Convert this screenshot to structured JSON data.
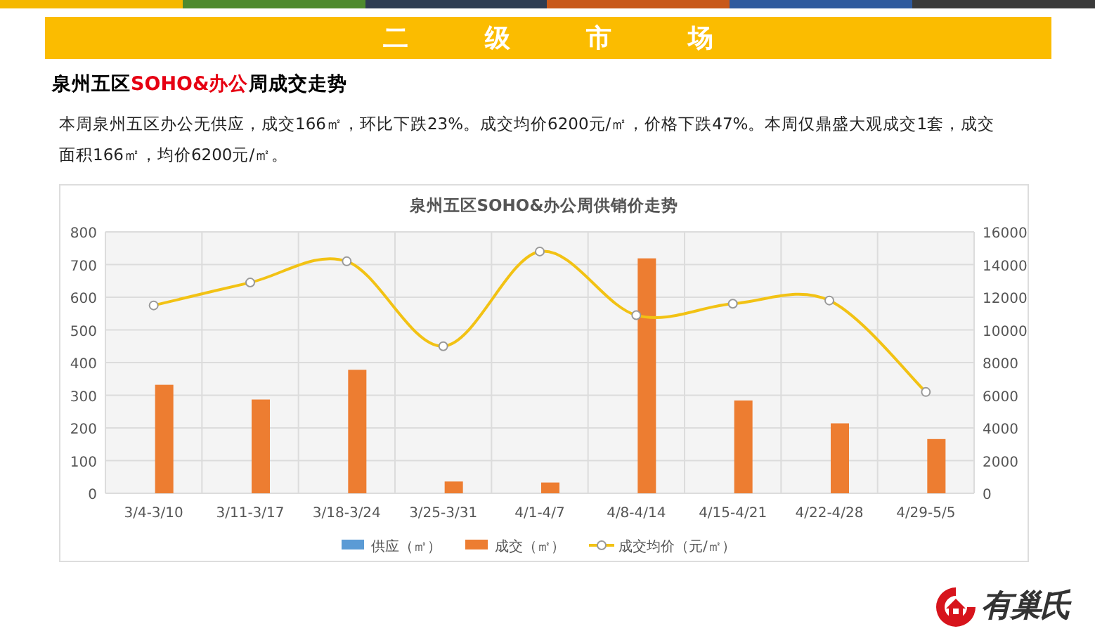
{
  "top_stripe": [
    {
      "color": "#f5b800"
    },
    {
      "color": "#4e8a2e"
    },
    {
      "color": "#2e3c52"
    },
    {
      "color": "#c8581a"
    },
    {
      "color": "#2f5a9e"
    },
    {
      "color": "#3a3a3a"
    }
  ],
  "banner": {
    "title": "二 级 市 场"
  },
  "heading": [
    {
      "text": "泉州五区",
      "highlight": false
    },
    {
      "text": "SOHO&办公",
      "highlight": true
    },
    {
      "text": "周成交走势",
      "highlight": false
    }
  ],
  "summary": "本周泉州五区办公无供应，成交166㎡，环比下跌23%。成交均价6200元/㎡，价格下跌47%。本周仅鼎盛大观成交1套，成交面积166㎡，均价6200元/㎡。",
  "chart_data": {
    "type": "bar",
    "title": "泉州五区SOHO&办公周供销价走势",
    "categories": [
      "3/4-3/10",
      "3/11-3/17",
      "3/18-3/24",
      "3/25-3/31",
      "4/1-4/7",
      "4/8-4/14",
      "4/15-4/21",
      "4/22-4/28",
      "4/29-5/5"
    ],
    "series": [
      {
        "name": "供应（㎡）",
        "color": "#5b9bd5",
        "values": [
          null,
          null,
          null,
          null,
          null,
          null,
          null,
          null,
          null
        ]
      },
      {
        "name": "成交（㎡）",
        "color": "#ed7d31",
        "values": [
          332,
          287,
          378,
          36,
          33,
          719,
          284,
          214,
          166
        ]
      },
      {
        "name": "成交均价（元/㎡）",
        "color": "#f2c214",
        "type": "line",
        "axis": "y2",
        "marker": "circle",
        "values": [
          11500,
          12900,
          14200,
          9000,
          14800,
          10900,
          11600,
          11800,
          6200
        ]
      }
    ],
    "grid": true,
    "legend": "bottom",
    "ylim": [
      0,
      800
    ],
    "yticks": [
      0,
      100,
      200,
      300,
      400,
      500,
      600,
      700,
      800
    ],
    "y2lim": [
      0,
      16000
    ],
    "y2ticks": [
      0,
      2000,
      4000,
      6000,
      8000,
      10000,
      12000,
      14000,
      16000
    ]
  },
  "logo": {
    "text": "有巢氏"
  }
}
